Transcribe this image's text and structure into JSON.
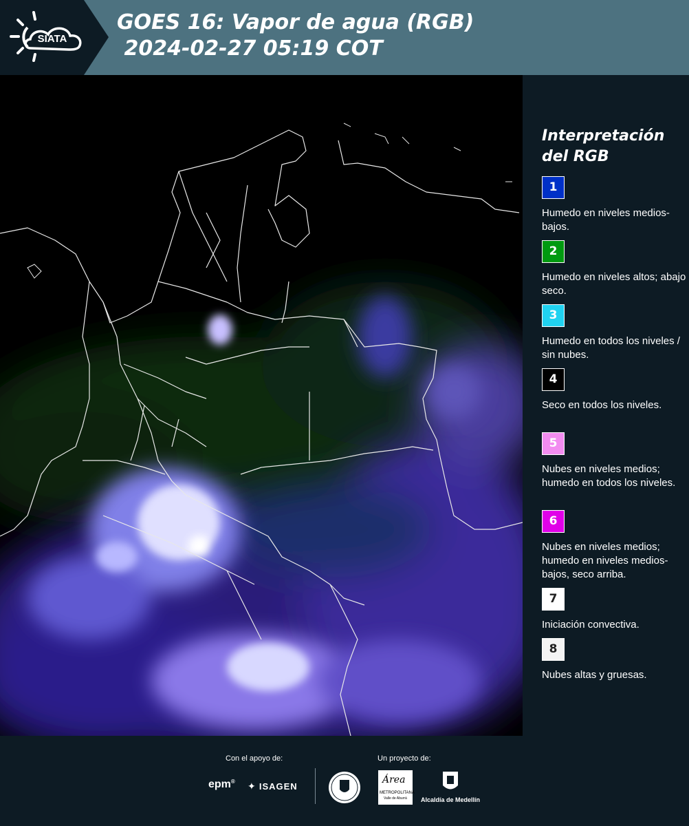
{
  "header": {
    "brand": "SIATA",
    "title_line1": "GOES 16: Vapor de agua (RGB)",
    "title_line2": " 2024-02-27 05:19 COT"
  },
  "map": {
    "icon": "satellite-image"
  },
  "legend": {
    "title": "Interpretación del RGB",
    "items": [
      {
        "number": "1",
        "color": "#0030c8",
        "text": "Humedo en niveles medios-bajos."
      },
      {
        "number": "2",
        "color": "#009a10",
        "text": "Humedo en niveles altos; abajo seco."
      },
      {
        "number": "3",
        "color": "#20d2f0",
        "text": "Humedo en todos los niveles / sin nubes."
      },
      {
        "number": "4",
        "color": "#000000",
        "text": "Seco en todos los niveles."
      },
      {
        "number": "5",
        "color": "#f28cf0",
        "text": "Nubes en niveles medios; humedo en todos los niveles."
      },
      {
        "number": "6",
        "color": "#e000e8",
        "text": "Nubes en niveles medios; humedo en niveles medios-bajos, seco arriba."
      },
      {
        "number": "7",
        "color": "#ffffff",
        "text": "Iniciación convectiva."
      },
      {
        "number": "8",
        "color": "#f4f4f4",
        "text": "Nubes altas y gruesas."
      }
    ]
  },
  "footer": {
    "support_label": "Con el apoyo de:",
    "project_label": "Un proyecto de:",
    "epm": "epm",
    "isagen": "ISAGEN",
    "metropolitana": "METROPOLITANA",
    "metropolitana_sub": "Valle de Aburrá",
    "area_script": "Área",
    "alcaldia": "Alcaldía de Medellín"
  }
}
